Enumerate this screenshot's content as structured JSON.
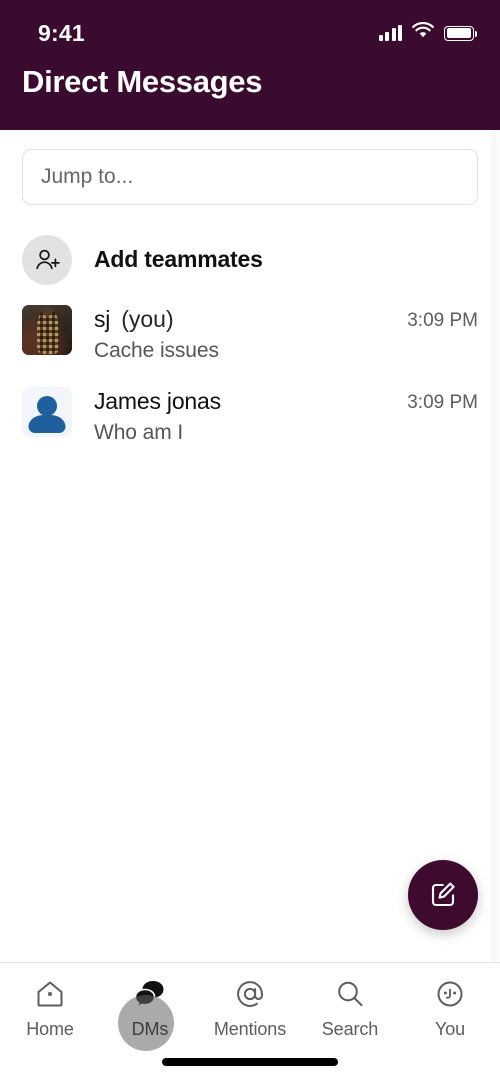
{
  "status_bar": {
    "time": "9:41",
    "icons": [
      "signal-icon",
      "wifi-icon",
      "battery-icon"
    ]
  },
  "header": {
    "title": "Direct Messages",
    "background_color": "#3a0b2e"
  },
  "search": {
    "placeholder": "Jump to...",
    "value": ""
  },
  "add_teammates": {
    "label": "Add teammates",
    "icon": "person-add-icon"
  },
  "dm_list": [
    {
      "name": "sj",
      "suffix": "(you)",
      "preview": "Cache issues",
      "time": "3:09 PM",
      "avatar": "photo-avatar"
    },
    {
      "name": "James jonas",
      "suffix": "",
      "preview": "Who am I",
      "time": "3:09 PM",
      "avatar": "person-silhouette-avatar"
    }
  ],
  "compose_button": {
    "icon": "compose-icon",
    "color": "#3e0b2f"
  },
  "tabbar": {
    "items": [
      {
        "label": "Home",
        "icon": "home-icon",
        "active": false
      },
      {
        "label": "DMs",
        "icon": "chat-bubbles-icon",
        "active": true
      },
      {
        "label": "Mentions",
        "icon": "at-sign-icon",
        "active": false
      },
      {
        "label": "Search",
        "icon": "search-icon",
        "active": false
      },
      {
        "label": "You",
        "icon": "face-circle-icon",
        "active": false
      }
    ]
  }
}
